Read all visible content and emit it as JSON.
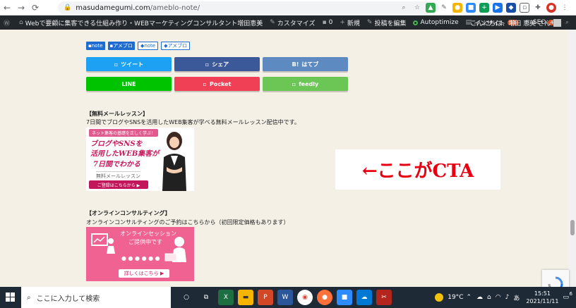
{
  "browser": {
    "url_host": "masudamegumi.com",
    "url_path": "/ameblo-note/"
  },
  "wp_admin": {
    "site_name": "Webで要顧に集客できる仕組み作り・WEBマーケティングコンサルタント増田恵美",
    "customize": "カスタマイズ",
    "comments": "0",
    "new": "新規",
    "edit_post": "投稿を編集",
    "autoptimize": "Autoptimize",
    "insight": "インサイト",
    "insight_badge": "11",
    "seo": "SEO",
    "seo_badge": "4",
    "greeting": "こんにちは、増田 恵美 さん"
  },
  "tags": [
    {
      "label": "note",
      "style": "solid"
    },
    {
      "label": "アメブロ",
      "style": "solid"
    },
    {
      "label": "note",
      "style": "outline"
    },
    {
      "label": "アメブロ",
      "style": "outline"
    }
  ],
  "share_buttons": [
    {
      "label": "ツイート",
      "color": "#1da1f2"
    },
    {
      "label": "シェア",
      "color": "#3b5998"
    },
    {
      "label": "はてブ",
      "color": "#5d8ac1"
    },
    {
      "label": "LINE",
      "color": "#00c300"
    },
    {
      "label": "Pocket",
      "color": "#ef4056"
    },
    {
      "label": "feedly",
      "color": "#6cc655"
    }
  ],
  "section1": {
    "title": "【無料メールレッスン】",
    "description": "7日間でブログやSNSを活用したWEB集客が学べる無料メールレッスン配信中です。",
    "banner_top": "ネット集客の基礎を正しく学ぶ！",
    "banner_line1": "ブログやSNSを",
    "banner_line2": "活用したWEB集客が",
    "banner_line3": "7日間でわかる",
    "banner_sub": "無料メールレッスン",
    "banner_button": "ご登録はこちらから ▶"
  },
  "cta_annotation": "←ここがCTA",
  "section2": {
    "title": "【オンラインコンサルティング】",
    "description": "オンラインコンサルティングのご予約はこちらから（初回限定価格もあります）",
    "banner_line1": "オンラインセッション",
    "banner_line2": "ご提供中です",
    "banner_button": "詳しくはこちら ▶"
  },
  "taskbar": {
    "search_placeholder": "ここに入力して検索",
    "temperature": "19°C",
    "ime": "あ",
    "time": "15:51",
    "date": "2021/11/11",
    "notification_count": "6"
  }
}
